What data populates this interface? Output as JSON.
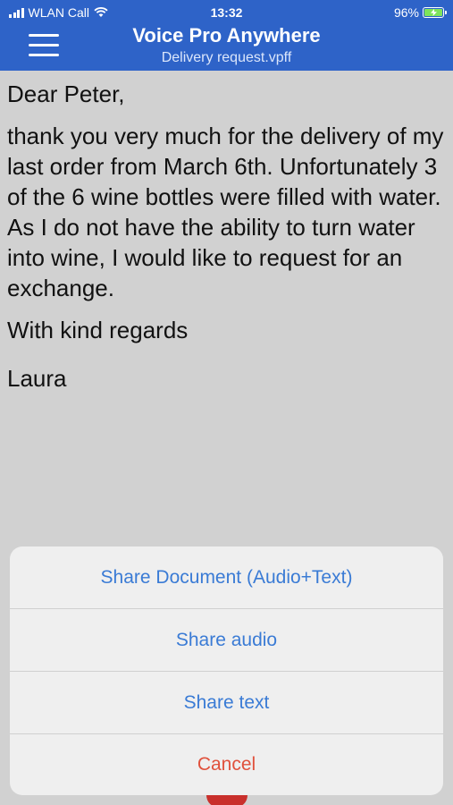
{
  "status_bar": {
    "carrier": "WLAN Call",
    "time": "13:32",
    "battery": "96%",
    "battery_level": 0.96
  },
  "header": {
    "title": "Voice Pro Anywhere",
    "filename": "Delivery request.vpff"
  },
  "document": {
    "greeting": "Dear Peter,",
    "body": "thank you very much for the delivery of my last order from March 6th. Unfortunately 3 of the 6 wine bottles were filled with water. As I do not have the ability to turn water into wine, I would like to request for an exchange.",
    "closing": "With kind regards",
    "signature": "Laura"
  },
  "share_sheet": {
    "share_document": "Share Document (Audio+Text)",
    "share_audio": "Share audio",
    "share_text": "Share text",
    "cancel": "Cancel"
  },
  "colors": {
    "header_bg": "#2e63c8",
    "action_blue": "#3a7bd5",
    "cancel_red": "#e0513c",
    "backdrop": "#d1d1d1"
  }
}
